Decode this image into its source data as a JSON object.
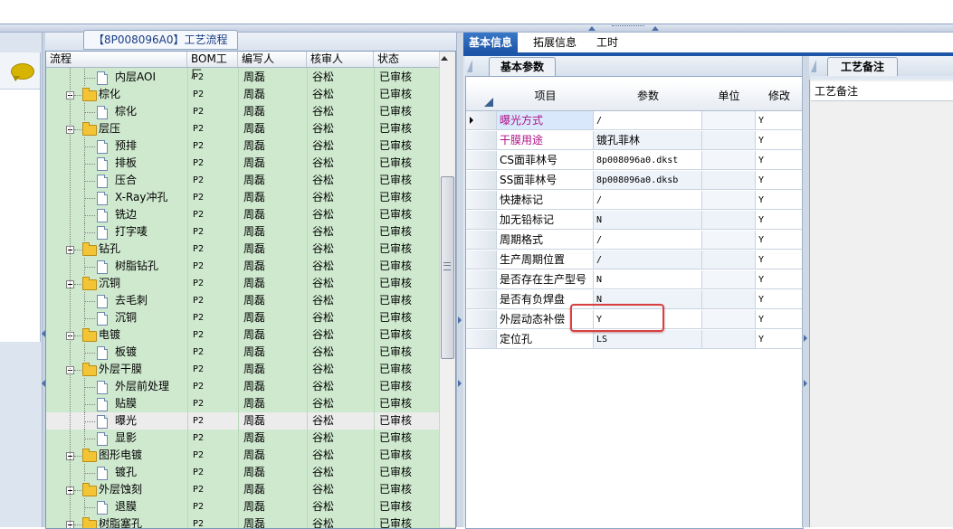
{
  "process_panel": {
    "title": "【8P008096A0】工艺流程",
    "columns": [
      "流程",
      "BOM工厂",
      "编写人",
      "核审人",
      "状态"
    ],
    "rows": [
      {
        "name": "内层AOI",
        "type": "doc",
        "level": 2,
        "bom": "P2",
        "author": "周磊",
        "reviewer": "谷松",
        "status": "已审核"
      },
      {
        "name": "棕化",
        "type": "folder",
        "level": 1,
        "bom": "P2",
        "author": "周磊",
        "reviewer": "谷松",
        "status": "已审核"
      },
      {
        "name": "棕化",
        "type": "doc",
        "level": 2,
        "bom": "P2",
        "author": "周磊",
        "reviewer": "谷松",
        "status": "已审核"
      },
      {
        "name": "层压",
        "type": "folder",
        "level": 1,
        "bom": "P2",
        "author": "周磊",
        "reviewer": "谷松",
        "status": "已审核"
      },
      {
        "name": "预排",
        "type": "doc",
        "level": 2,
        "bom": "P2",
        "author": "周磊",
        "reviewer": "谷松",
        "status": "已审核"
      },
      {
        "name": "排板",
        "type": "doc",
        "level": 2,
        "bom": "P2",
        "author": "周磊",
        "reviewer": "谷松",
        "status": "已审核"
      },
      {
        "name": "压合",
        "type": "doc",
        "level": 2,
        "bom": "P2",
        "author": "周磊",
        "reviewer": "谷松",
        "status": "已审核"
      },
      {
        "name": "X-Ray冲孔",
        "type": "doc",
        "level": 2,
        "bom": "P2",
        "author": "周磊",
        "reviewer": "谷松",
        "status": "已审核"
      },
      {
        "name": "铣边",
        "type": "doc",
        "level": 2,
        "bom": "P2",
        "author": "周磊",
        "reviewer": "谷松",
        "status": "已审核"
      },
      {
        "name": "打字唛",
        "type": "doc",
        "level": 2,
        "bom": "P2",
        "author": "周磊",
        "reviewer": "谷松",
        "status": "已审核"
      },
      {
        "name": "钻孔",
        "type": "folder",
        "level": 1,
        "bom": "P2",
        "author": "周磊",
        "reviewer": "谷松",
        "status": "已审核"
      },
      {
        "name": "树脂钻孔",
        "type": "doc",
        "level": 2,
        "bom": "P2",
        "author": "周磊",
        "reviewer": "谷松",
        "status": "已审核"
      },
      {
        "name": "沉铜",
        "type": "folder",
        "level": 1,
        "bom": "P2",
        "author": "周磊",
        "reviewer": "谷松",
        "status": "已审核"
      },
      {
        "name": "去毛刺",
        "type": "doc",
        "level": 2,
        "bom": "P2",
        "author": "周磊",
        "reviewer": "谷松",
        "status": "已审核"
      },
      {
        "name": "沉铜",
        "type": "doc",
        "level": 2,
        "bom": "P2",
        "author": "周磊",
        "reviewer": "谷松",
        "status": "已审核"
      },
      {
        "name": "电镀",
        "type": "folder",
        "level": 1,
        "bom": "P2",
        "author": "周磊",
        "reviewer": "谷松",
        "status": "已审核"
      },
      {
        "name": "板镀",
        "type": "doc",
        "level": 2,
        "bom": "P2",
        "author": "周磊",
        "reviewer": "谷松",
        "status": "已审核"
      },
      {
        "name": "外层干膜",
        "type": "folder",
        "level": 1,
        "bom": "P2",
        "author": "周磊",
        "reviewer": "谷松",
        "status": "已审核"
      },
      {
        "name": "外层前处理",
        "type": "doc",
        "level": 2,
        "bom": "P2",
        "author": "周磊",
        "reviewer": "谷松",
        "status": "已审核"
      },
      {
        "name": "贴膜",
        "type": "doc",
        "level": 2,
        "bom": "P2",
        "author": "周磊",
        "reviewer": "谷松",
        "status": "已审核"
      },
      {
        "name": "曝光",
        "type": "doc",
        "level": 2,
        "bom": "P2",
        "author": "周磊",
        "reviewer": "谷松",
        "status": "已审核",
        "selected": true
      },
      {
        "name": "显影",
        "type": "doc",
        "level": 2,
        "bom": "P2",
        "author": "周磊",
        "reviewer": "谷松",
        "status": "已审核"
      },
      {
        "name": "图形电镀",
        "type": "folder",
        "level": 1,
        "bom": "P2",
        "author": "周磊",
        "reviewer": "谷松",
        "status": "已审核"
      },
      {
        "name": "镀孔",
        "type": "doc",
        "level": 2,
        "bom": "P2",
        "author": "周磊",
        "reviewer": "谷松",
        "status": "已审核"
      },
      {
        "name": "外层蚀刻",
        "type": "folder",
        "level": 1,
        "bom": "P2",
        "author": "周磊",
        "reviewer": "谷松",
        "status": "已审核"
      },
      {
        "name": "退膜",
        "type": "doc",
        "level": 2,
        "bom": "P2",
        "author": "周磊",
        "reviewer": "谷松",
        "status": "已审核"
      },
      {
        "name": "树脂塞孔",
        "type": "folder",
        "level": 1,
        "bom": "P2",
        "author": "周磊",
        "reviewer": "谷松",
        "status": "已审核"
      }
    ]
  },
  "right_tabs": [
    "基本信息",
    "拓展信息",
    "工时"
  ],
  "active_right_tab": "基本信息",
  "basic_params": {
    "tab_label": "基本参数",
    "columns": [
      "项目",
      "参数",
      "单位",
      "修改"
    ],
    "rows": [
      {
        "item": "曝光方式",
        "param": "/",
        "unit": "",
        "modify": "Y",
        "item_color": "#b0128a",
        "current": true
      },
      {
        "item": "干膜用途",
        "param": "镀孔菲林",
        "unit": "",
        "modify": "Y",
        "item_color": "#b0128a"
      },
      {
        "item": "CS面菲林号",
        "param": "8p008096a0.dkst",
        "unit": "",
        "modify": "Y",
        "item_color": "#000000"
      },
      {
        "item": "SS面菲林号",
        "param": "8p008096a0.dksb",
        "unit": "",
        "modify": "Y",
        "item_color": "#000000"
      },
      {
        "item": "快捷标记",
        "param": "/",
        "unit": "",
        "modify": "Y",
        "item_color": "#000000"
      },
      {
        "item": "加无铅标记",
        "param": "N",
        "unit": "",
        "modify": "Y",
        "item_color": "#000000"
      },
      {
        "item": "周期格式",
        "param": "/",
        "unit": "",
        "modify": "Y",
        "item_color": "#000000"
      },
      {
        "item": "生产周期位置",
        "param": "/",
        "unit": "",
        "modify": "Y",
        "item_color": "#000000"
      },
      {
        "item": "是否存在生产型号",
        "param": "N",
        "unit": "",
        "modify": "Y",
        "item_color": "#000000"
      },
      {
        "item": "是否有负焊盘",
        "param": "N",
        "unit": "",
        "modify": "Y",
        "item_color": "#000000"
      },
      {
        "item": "外层动态补偿",
        "param": "Y",
        "unit": "",
        "modify": "Y",
        "item_color": "#000000",
        "highlighted": true
      },
      {
        "item": "定位孔",
        "param": "LS",
        "unit": "",
        "modify": "Y",
        "item_color": "#000000"
      }
    ]
  },
  "notes_panel": {
    "tab_label": "工艺备注",
    "header": "工艺备注"
  },
  "colors": {
    "tree_bg": "#cfe9cf",
    "tab_active": "#1d55a8",
    "highlight_box": "#d94040"
  },
  "icons": {
    "chat": "speech-bubble-icon",
    "folder": "folder-icon",
    "document": "document-icon",
    "row_indicator": "triangle-right-icon"
  }
}
